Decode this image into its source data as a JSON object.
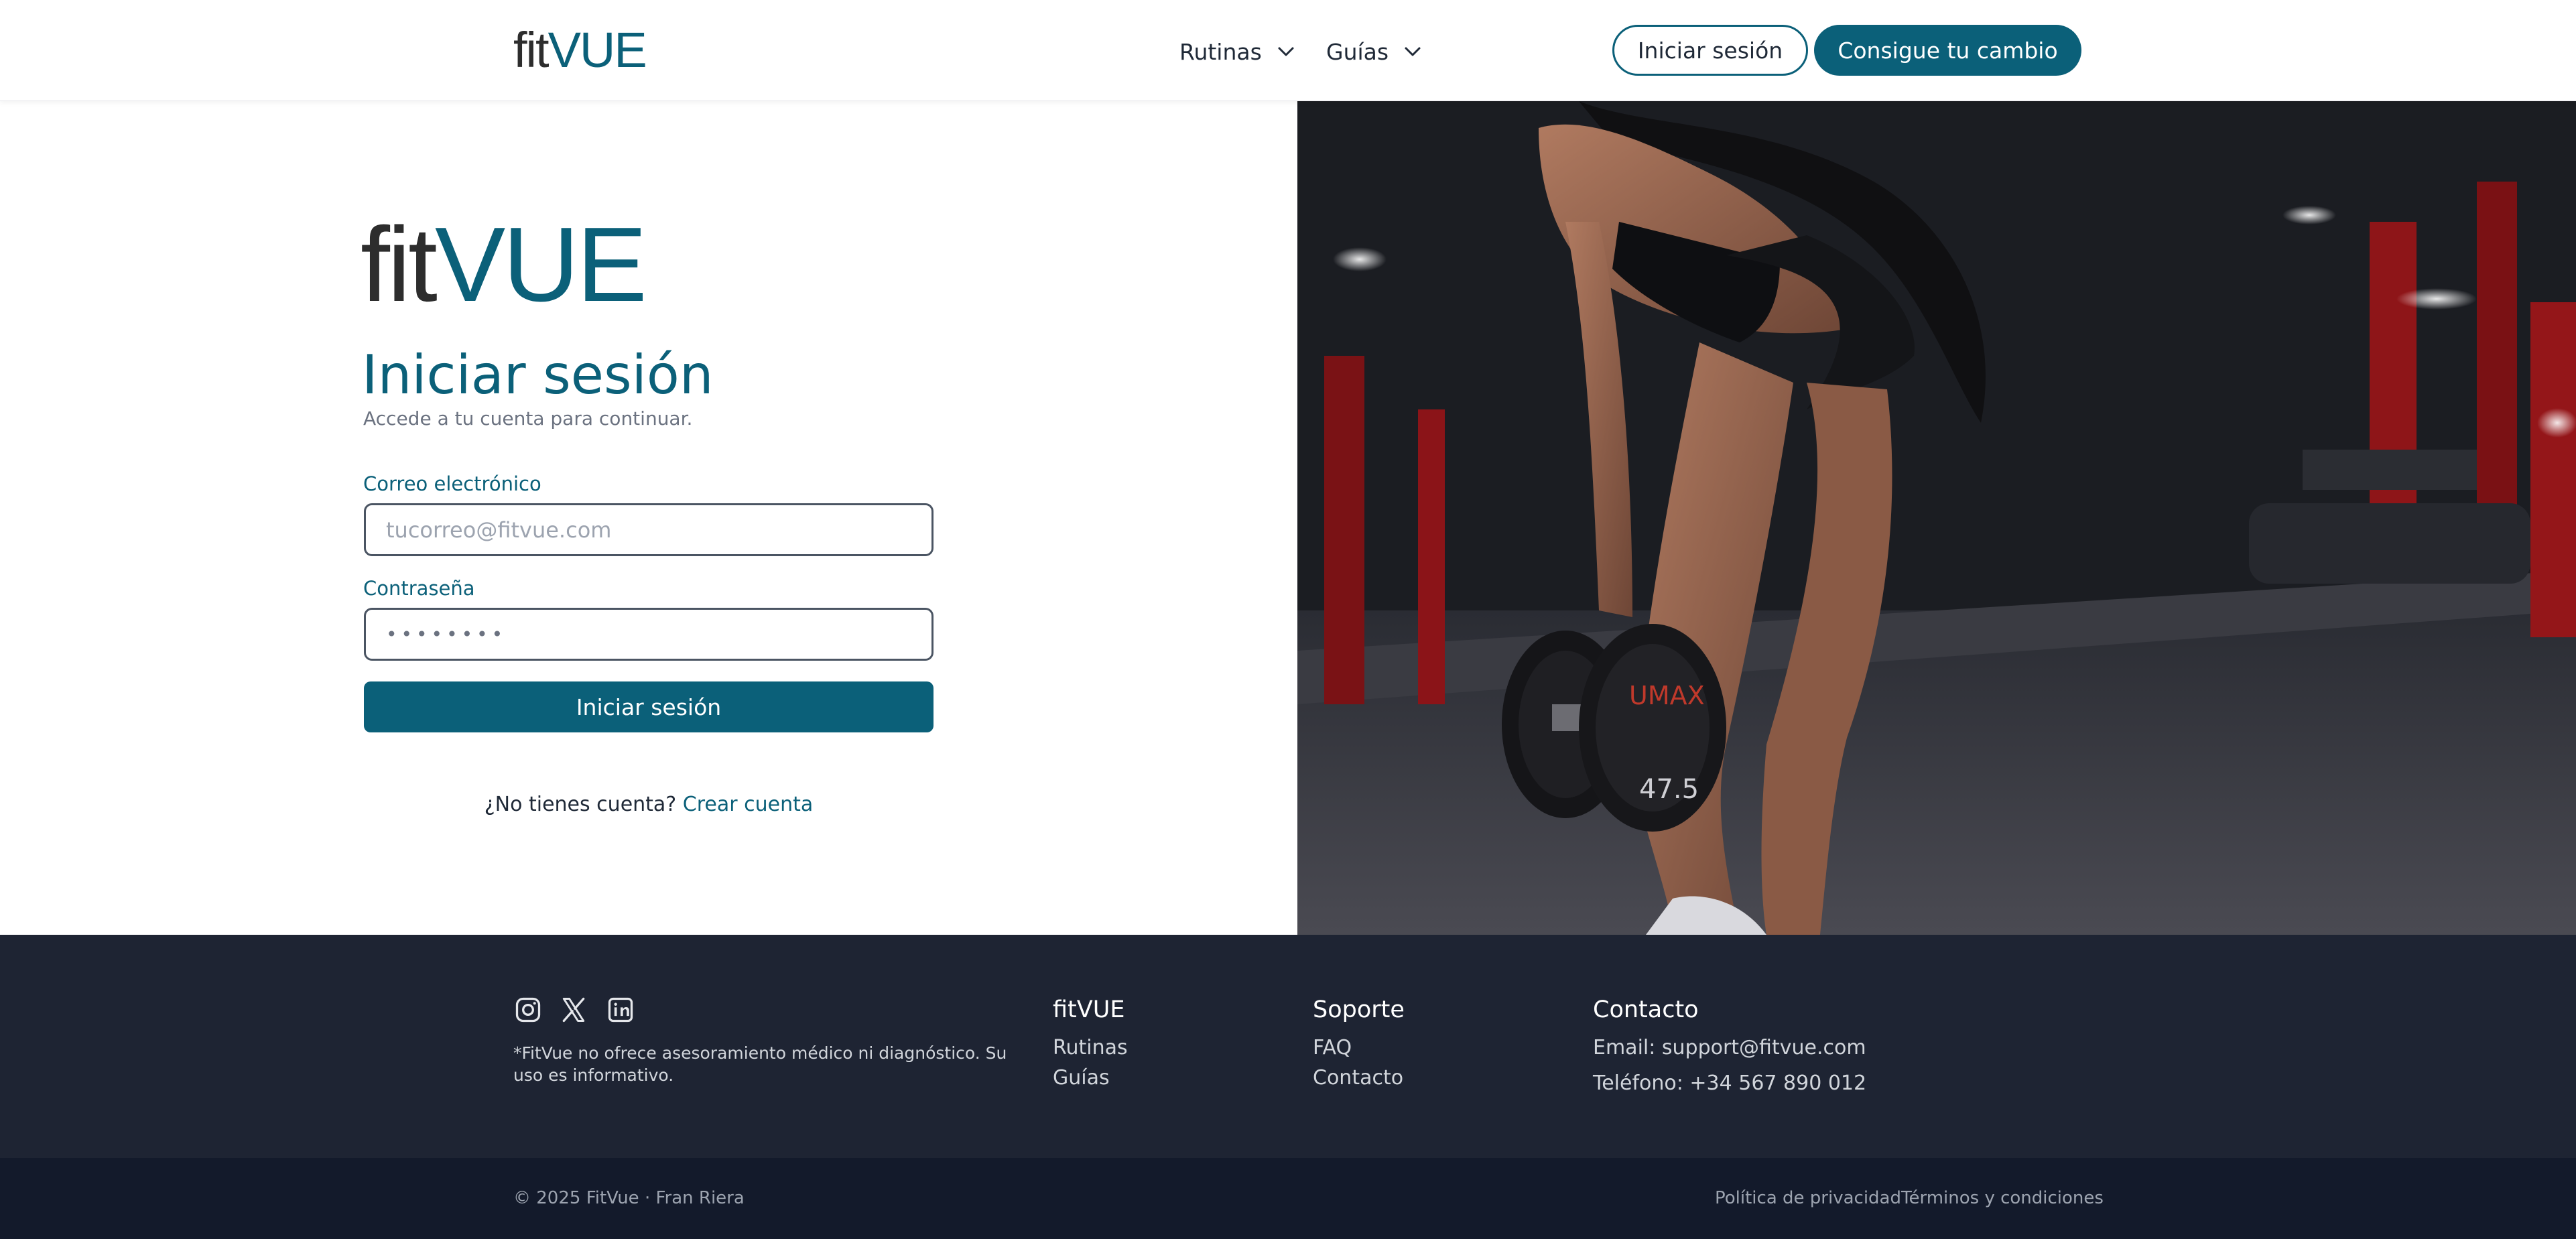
{
  "header": {
    "logo_fit": "fit",
    "logo_vue": "VUE",
    "nav": [
      {
        "label": "Rutinas"
      },
      {
        "label": "Guías"
      }
    ],
    "login_button": "Iniciar sesión",
    "cta_button": "Consigue tu cambio"
  },
  "login": {
    "logo_fit": "fit",
    "logo_vue": "VUE",
    "title": "Iniciar sesión",
    "subtitle": "Accede a tu cuenta para continuar.",
    "email_label": "Correo electrónico",
    "email_placeholder": "tucorreo@fitvue.com",
    "password_label": "Contraseña",
    "password_value": "••••••••",
    "submit_label": "Iniciar sesión",
    "signup_prompt": "¿No tienes cuenta?",
    "signup_link": "Crear cuenta"
  },
  "hero": {
    "dumbbell_text_1": "UMAX",
    "dumbbell_text_2": "47.5"
  },
  "footer": {
    "social": [
      "instagram-icon",
      "x-icon",
      "linkedin-icon"
    ],
    "disclaimer": "*FitVue no ofrece asesoramiento médico ni diagnóstico. Su uso es informativo.",
    "col1": {
      "title": "fitVUE",
      "links": [
        "Rutinas",
        "Guías"
      ]
    },
    "col2": {
      "title": "Soporte",
      "links": [
        "FAQ",
        "Contacto"
      ]
    },
    "col3": {
      "title": "Contacto",
      "email": "Email: support@fitvue.com",
      "phone": "Teléfono: +34 567 890 012"
    },
    "copyright": "© 2025 FitVue · Fran Riera",
    "privacy": "Política de privacidad",
    "terms": "Términos y condiciones"
  },
  "colors": {
    "brand": "#0b6079",
    "footer_bg": "#1e2433",
    "footer_bottom_bg": "#131a2b"
  }
}
